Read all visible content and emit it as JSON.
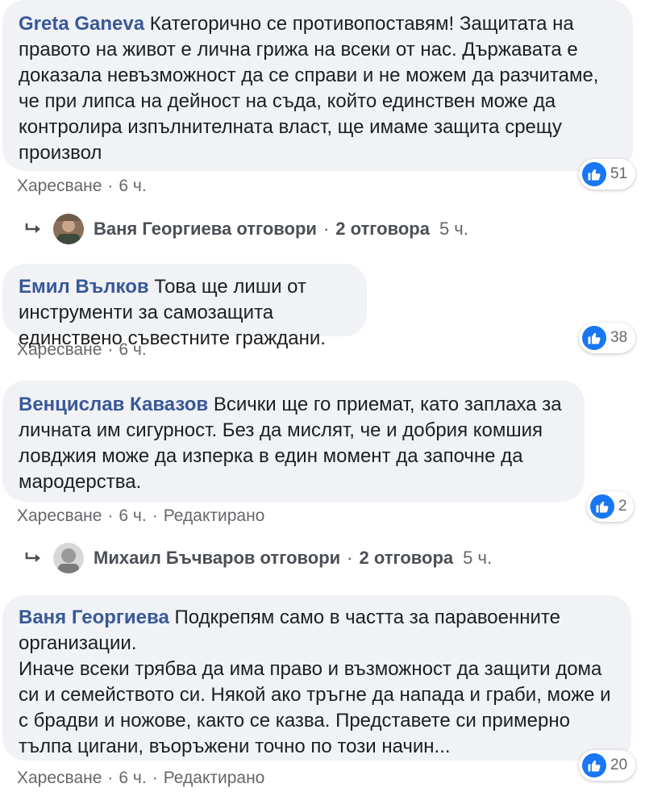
{
  "comments": [
    {
      "author": "Greta Ganeva",
      "text": "Категорично се противопоставям! Защитата на правото на живот е лична грижа на всеки от нас. Държавата е доказала невъзможност да се справи и не можем да разчитаме, че при липса на дейност на съда, който единствен може да контролира изпълнителната власт, ще имаме защита срещу произвол",
      "like_label": "Харесване",
      "time": "6 ч.",
      "reactions": "51"
    },
    {
      "author": "Емил Вълков",
      "text": "Това ще лиши от инструменти за самозащита единствено съвестните граждани.",
      "like_label": "Харесване",
      "time": "6 ч.",
      "reactions": "38"
    },
    {
      "author": "Венцислав Кавазов",
      "text": "Всички ще го приемат, като заплаха за личната им сигурност. Без да мислят, че и добрия комшия ловджия може да изперка в един момент да започне да мародерства.",
      "like_label": "Харесване",
      "time": "6 ч.",
      "edited": "Редактирано",
      "reactions": "2"
    },
    {
      "author": "Ваня Георгиева",
      "text": "Подкрепям само в частта за паравоенните организации.",
      "text2": "Иначе всеки трябва да има право и възможност да защити дома си и семейството си. Някой ако тръгне да напада и граби, може и с брадви и ножове, както се казва. Представете си примерно тълпа цигани, въоръжени точно по този начин...",
      "like_label": "Харесване",
      "time": "6 ч.",
      "edited": "Редактирано",
      "reactions": "20"
    }
  ],
  "replies": [
    {
      "name_text": "Ваня Георгиева отговори",
      "count": "2 отговора",
      "time": "5 ч."
    },
    {
      "name_text": "Михаил Бъчваров отговори",
      "count": "2 отговора",
      "time": "5 ч."
    }
  ],
  "separator": "·",
  "colors": {
    "bubble": "#f0f2f5",
    "author": "#385898",
    "meta": "#65676b",
    "like_blue": "#1877f2"
  }
}
